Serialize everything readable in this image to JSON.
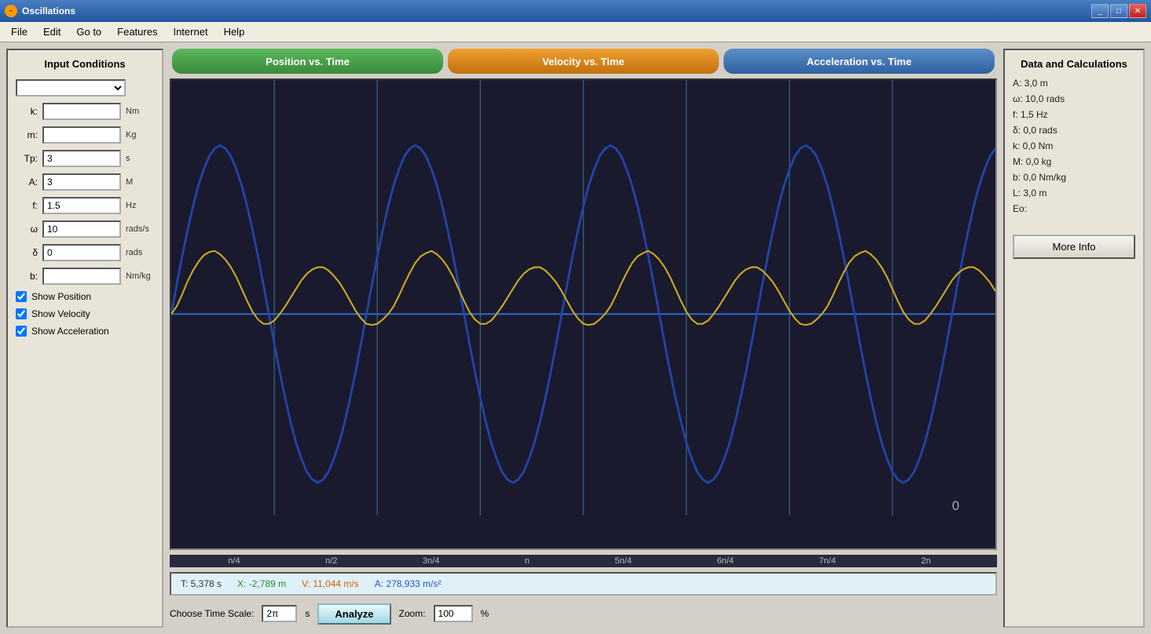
{
  "titleBar": {
    "icon": "~",
    "title": "Oscillations",
    "minimizeLabel": "_",
    "maximizeLabel": "□",
    "closeLabel": "✕"
  },
  "menuBar": {
    "items": [
      "File",
      "Edit",
      "Go to",
      "Features",
      "Internet",
      "Help"
    ]
  },
  "leftPanel": {
    "title": "Input Conditions",
    "dropdown": "",
    "fields": [
      {
        "label": "k:",
        "value": "",
        "unit": "Nm"
      },
      {
        "label": "m:",
        "value": "",
        "unit": "Kg"
      },
      {
        "label": "Tp:",
        "value": "3",
        "unit": "s"
      },
      {
        "label": "A:",
        "value": "3",
        "unit": "M"
      },
      {
        "label": "f:",
        "value": "1.5",
        "unit": "Hz"
      },
      {
        "label": "ω",
        "value": "10",
        "unit": "rads/s"
      },
      {
        "label": "δ",
        "value": "0",
        "unit": "rads"
      },
      {
        "label": "b:",
        "value": "",
        "unit": "Nm/kg"
      }
    ],
    "checkboxes": [
      {
        "label": "Show Position",
        "checked": true
      },
      {
        "label": "Show Velocity",
        "checked": true
      },
      {
        "label": "Show Acceleration",
        "checked": true
      }
    ]
  },
  "graphTabs": [
    {
      "label": "Position vs. Time",
      "class": "tab-position"
    },
    {
      "label": "Velocity vs. Time",
      "class": "tab-velocity"
    },
    {
      "label": "Acceleration vs. Time",
      "class": "tab-acceleration"
    }
  ],
  "graphXLabels": [
    "n/4",
    "n/2",
    "3n/4",
    "n",
    "5n/4",
    "6n/4",
    "7n/4",
    "2n"
  ],
  "graphZeroLabel": "0",
  "statusBar": {
    "t": "T: 5,378 s",
    "x": "X: -2,789 m",
    "v": "V: 11,044 m/s",
    "a": "A: 278,933 m/s²"
  },
  "bottomControls": {
    "timeScaleLabel": "Choose Time Scale:",
    "timeScaleValue": "2π",
    "timeScaleUnit": "s",
    "analyzeLabel": "Analyze",
    "zoomLabel": "Zoom:",
    "zoomValue": "100",
    "zoomUnit": "%"
  },
  "rightPanel": {
    "title": "Data and Calculations",
    "dataRows": [
      "A: 3,0 m",
      "ω: 10,0 rads",
      "f: 1,5 Hz",
      "δ: 0,0 rads",
      "k: 0,0 Nm",
      "M: 0,0 kg",
      "b: 0,0 Nm/kg",
      "L: 3,0 m",
      "Eo:"
    ],
    "moreInfoLabel": "More Info"
  }
}
